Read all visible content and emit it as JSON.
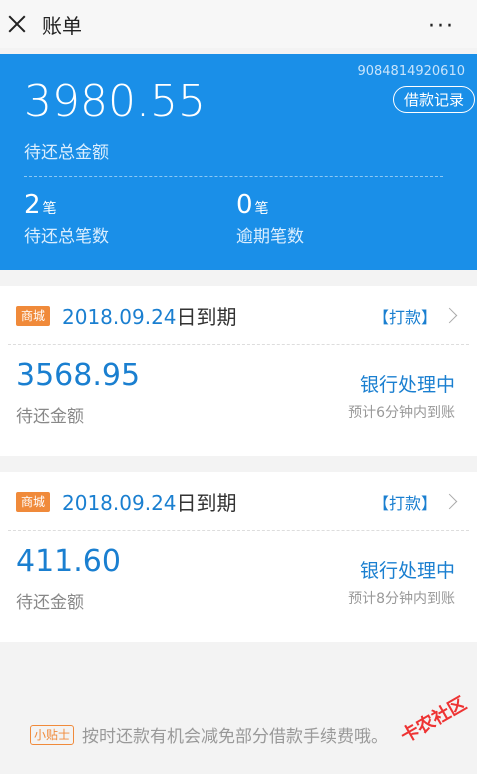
{
  "header": {
    "title": "账单",
    "more": "···"
  },
  "summary": {
    "account_number": "9084814920610",
    "records_button": "借款记录",
    "total_amount": "3980.55",
    "total_label": "待还总金额",
    "count_value": "2",
    "count_unit": "笔",
    "count_label": "待还总笔数",
    "overdue_value": "0",
    "overdue_unit": "笔",
    "overdue_label": "逾期笔数"
  },
  "cards": [
    {
      "tag": "商城",
      "date": "2018.09.24",
      "date_suffix": "日到期",
      "action": "【打款】",
      "amount": "3568.95",
      "amount_label": "待还金额",
      "status": "银行处理中",
      "eta": "预计6分钟内到账"
    },
    {
      "tag": "商城",
      "date": "2018.09.24",
      "date_suffix": "日到期",
      "action": "【打款】",
      "amount": "411.60",
      "amount_label": "待还金额",
      "status": "银行处理中",
      "eta": "预计8分钟内到账"
    }
  ],
  "tip": {
    "badge": "小贴士",
    "text": "按时还款有机会减免部分借款手续费哦。"
  },
  "watermark": "卡农社区"
}
